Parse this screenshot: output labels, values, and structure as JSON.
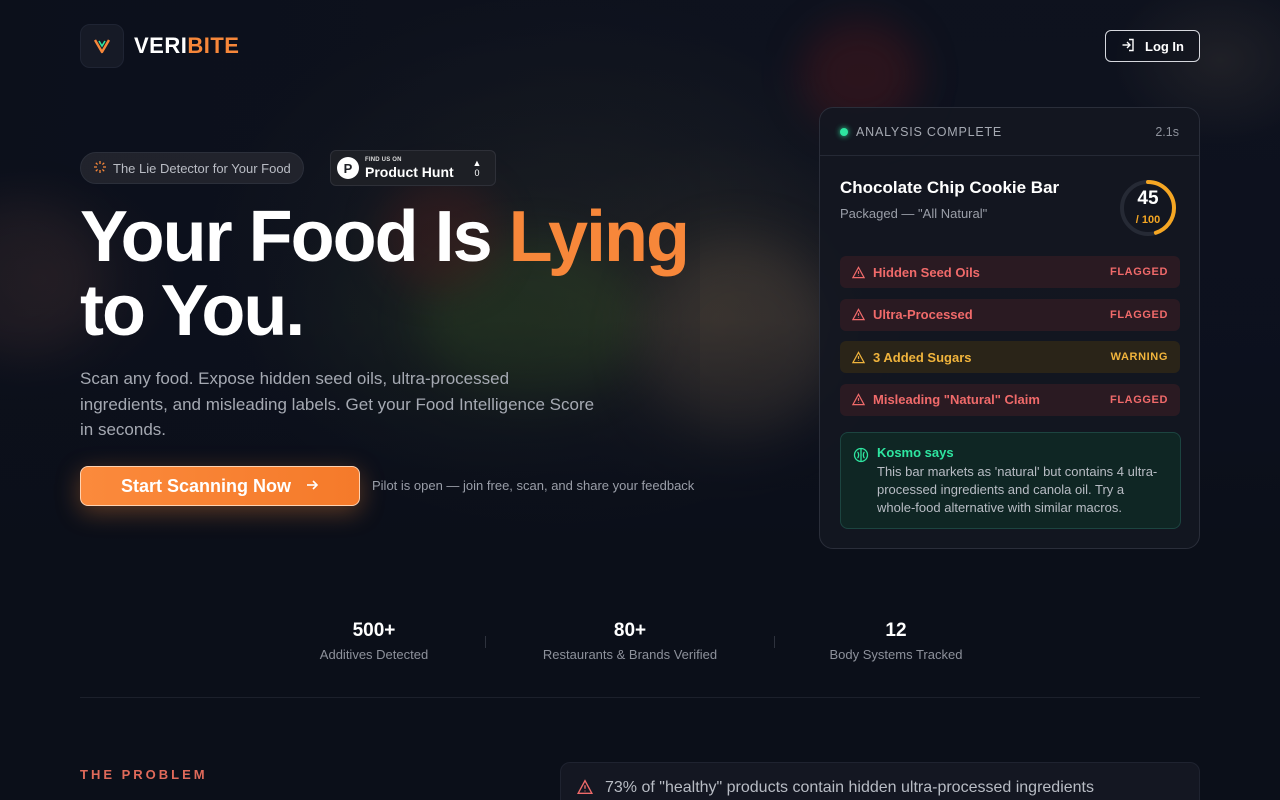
{
  "header": {
    "logo_text_a": "VERI",
    "logo_text_b": "BITE",
    "login_label": "Log In"
  },
  "hero": {
    "pill_label": "The Lie Detector for Your Food",
    "producthunt": {
      "small": "FIND US ON",
      "big": "Product Hunt",
      "votes": "0"
    },
    "headline_part1": "Your Food Is ",
    "headline_highlight": "Lying",
    "headline_part2": "to You.",
    "subtext": "Scan any food. Expose hidden seed oils, ultra-processed ingredients, and misleading labels. Get your Food Intelligence Score in seconds.",
    "cta_label": "Start Scanning Now",
    "cta_note": "Pilot is open — join free, scan, and share your feedback"
  },
  "analysis": {
    "status": "ANALYSIS COMPLETE",
    "time": "2.1s",
    "product_name": "Chocolate Chip Cookie Bar",
    "product_sub": "Packaged — \"All Natural\"",
    "score": "45",
    "score_max": "/ 100",
    "score_value": 45,
    "flags": [
      {
        "label": "Hidden Seed Oils",
        "tag": "FLAGGED",
        "level": "red"
      },
      {
        "label": "Ultra-Processed",
        "tag": "FLAGGED",
        "level": "red"
      },
      {
        "label": "3 Added Sugars",
        "tag": "WARNING",
        "level": "amber"
      },
      {
        "label": "Misleading \"Natural\" Claim",
        "tag": "FLAGGED",
        "level": "red"
      }
    ],
    "kosmo_title": "Kosmo says",
    "kosmo_text": "This bar markets as 'natural' but contains 4 ultra-processed ingredients and canola oil. Try a whole-food alternative with similar macros."
  },
  "stats": [
    {
      "value": "500+",
      "label": "Additives Detected"
    },
    {
      "value": "80+",
      "label": "Restaurants & Brands Verified"
    },
    {
      "value": "12",
      "label": "Body Systems Tracked"
    }
  ],
  "problem": {
    "label": "THE PROBLEM",
    "first_item": "73% of \"healthy\" products contain hidden ultra-processed ingredients"
  },
  "colors": {
    "accent": "#f7873a",
    "success": "#2ee5a0",
    "danger": "#f06a6a",
    "warning": "#f1b43c",
    "background": "#0b0f19"
  }
}
